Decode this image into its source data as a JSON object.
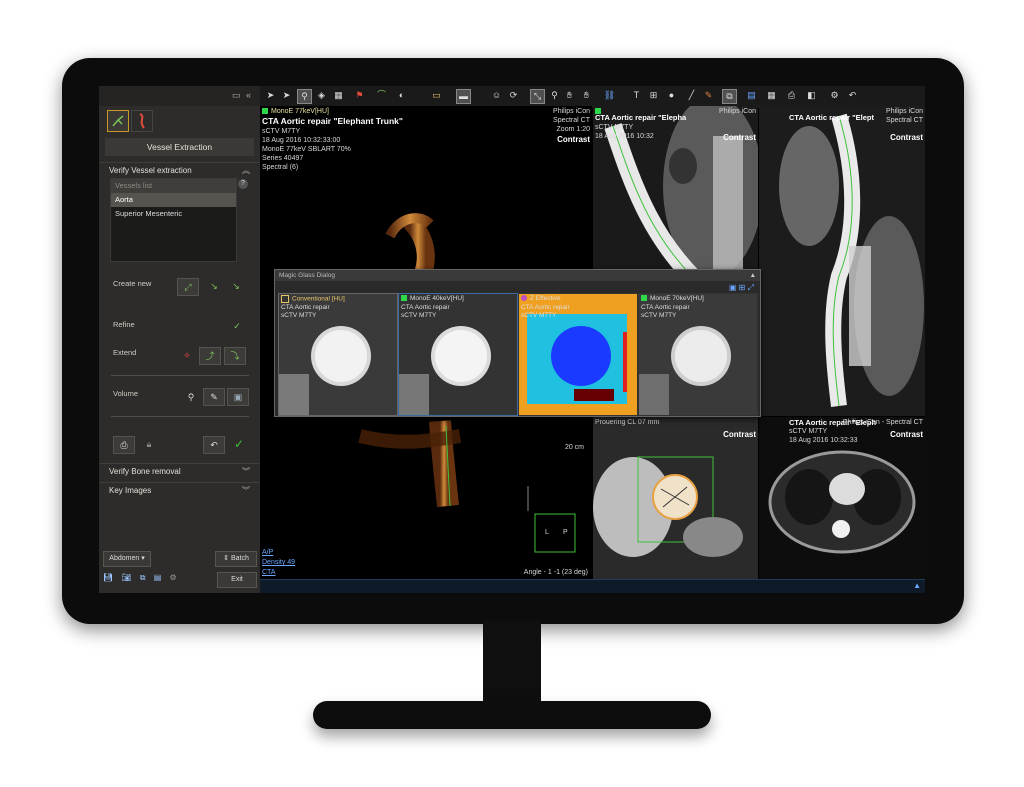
{
  "left_panel": {
    "title": "Vessel Extraction",
    "verify_vessel_label": "Verify Vessel extraction",
    "vessels_list_label": "Vessels list",
    "vessels": [
      "Aorta",
      "Superior Mesenteric"
    ],
    "help_label": "?",
    "create_new_label": "Create new",
    "refine_label": "Refine",
    "extend_label": "Extend",
    "volume_label": "Volume",
    "verify_bone_label": "Verify Bone removal",
    "key_images_label": "Key Images",
    "abdomen_label": "Abdomen",
    "batch_label": "Batch",
    "exit_label": "Exit"
  },
  "main_viewport": {
    "title": "CTA  Aortic repair \"Elephant Trunk\"",
    "line_mono": "MonoE 77keV[HU]",
    "line_id": "sCTV M7TY",
    "line_date": "18 Aug 2016 10:32:33:00",
    "line_recon": "MonoE 77keV SBLART 70%",
    "line_series": "Series 40497",
    "line_spectral": "Spectral (6)",
    "top_right_1": "Philips iCon",
    "top_right_2": "Spectral CT",
    "zoom": "Zoom 1:20",
    "contrast": "Contrast",
    "scale": "20 cm",
    "bottom_left_1": "A/P",
    "bottom_left_2": "Density 49",
    "bottom_left_3": "CTA",
    "angle": "Angle - 1 -1 (23 deg)",
    "orient_l": "L",
    "orient_p": "P"
  },
  "sag_viewport": {
    "title": "CTA  Aortic repair \"Elepha",
    "line_id": "sCTV M7TY",
    "line_date": "18 Aug 2016 10:32",
    "top_right_1": "Philips iCon",
    "contrast": "Contrast"
  },
  "cor_viewport": {
    "title": "CTA  Aortic repair \"Elept",
    "top_right_1": "Philips iCon",
    "top_right_2": "Spectral CT",
    "contrast": "Contrast"
  },
  "crosscut_viewport": {
    "title": "Prouering CL 07 mm",
    "top_right": "Contrast"
  },
  "axial_viewport": {
    "title": "CTA  Aortic repair \"Eleph",
    "line_id": "sCTV M7TY",
    "line_date": "18 Aug 2016 10:32:33",
    "top_right": "Philips iCon - Spectral CT",
    "contrast": "Contrast"
  },
  "dialog": {
    "title": "Magic Glass Dialog",
    "tiles": [
      {
        "label": "Conventional [HU]",
        "sub": "CTA  Aortic repair",
        "id": "sCTV M7TY"
      },
      {
        "label": "MonoE 40keV[HU]",
        "sub": "CTA  Aortic repair",
        "id": "sCTV M7TY"
      },
      {
        "label": "Z Effective",
        "sub": "CTA  Aortic repair",
        "id": "sCTV M7TY"
      },
      {
        "label": "MonoE 70keV[HU]",
        "sub": "CTA  Aortic repair",
        "id": "sCTV M7TY"
      }
    ]
  },
  "colors": {
    "accent_green": "#2fd84a",
    "panel_bg": "#2d2c2a",
    "link_blue": "#6aa6ff"
  }
}
